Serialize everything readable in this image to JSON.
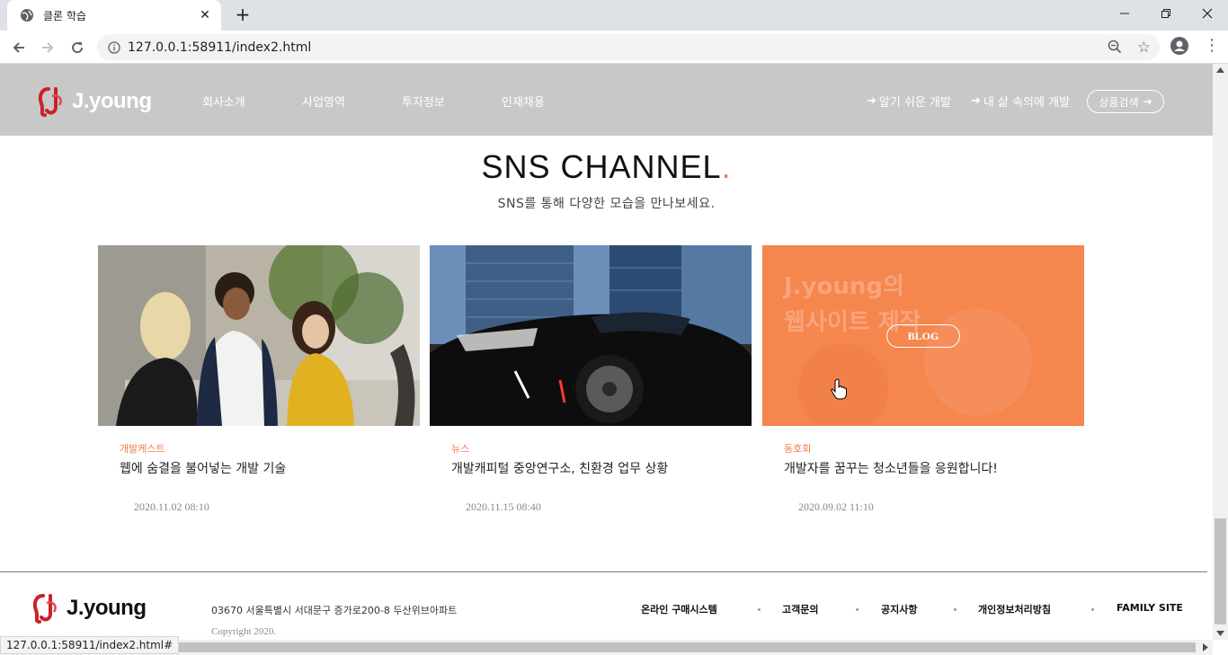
{
  "browser": {
    "tab_title": "클론 학습",
    "url": "127.0.0.1:58911/index2.html",
    "status_url": "127.0.0.1:58911/index2.html#"
  },
  "header": {
    "logo_text": "J.young",
    "nav": [
      "회사소개",
      "사업영역",
      "투자정보",
      "인재채용"
    ],
    "util_links": [
      "알기 쉬운 개발",
      "내 삶 속의에 개발"
    ],
    "search_label": "상품검색"
  },
  "section": {
    "title": "SNS CHANNEL",
    "title_dot": ".",
    "subtitle": "SNS를 통해 다양한 모습을 만나보세요."
  },
  "cards": [
    {
      "category": "개발케스트",
      "title": "웹에 숨결을 불어넣는 개발 기술",
      "date": "2020.11.02 08:10"
    },
    {
      "category": "뉴스",
      "title": "개발캐피털 중앙연구소, 친환경 업무 상황",
      "date": "2020.11.15 08:40"
    },
    {
      "category": "동호회",
      "title": "개발자를 꿈꾸는 청소년들을 응원합니다!",
      "date": "2020.09.02 11:10",
      "overlay_text_1": "J.young의",
      "overlay_text_2": "웹사이트 제작",
      "button": "BLOG"
    }
  ],
  "footer": {
    "logo_text": "J.young",
    "address": "03670 서울특별시 서대문구 증가로200-8 두산위브아파트",
    "copyright": "Copyright 2020.",
    "links": [
      "온라인 구매시스템",
      "고객문의",
      "공지사항",
      "개인정보처리방침",
      "FAMILY SITE"
    ]
  },
  "colors": {
    "accent": "#f47c48",
    "header_bg": "#c8c8c8"
  }
}
